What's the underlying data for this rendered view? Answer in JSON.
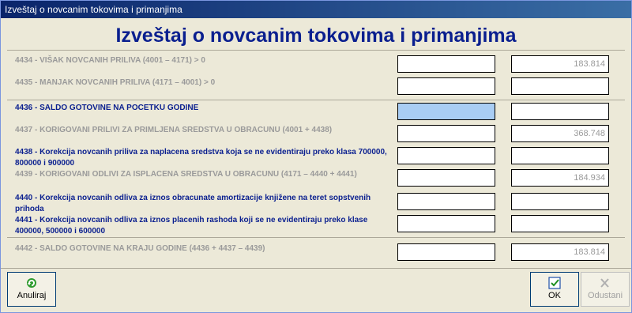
{
  "window": {
    "title": "Izveštaj o novcanim tokovima i primanjima"
  },
  "heading": "Izveštaj o novcanim tokovima i primanjima",
  "rows": [
    {
      "label": "4434 - VIŠAK NOVCANIH PRILIVA (4001 – 4171) > 0",
      "left": "",
      "right": "183.814"
    },
    {
      "label": "4435 - MANJAK NOVCANIH PRILIVA (4171 – 4001) > 0",
      "left": "",
      "right": ""
    },
    {
      "label": "4436 - SALDO GOTOVINE NA POCETKU GODINE",
      "left": "",
      "right": ""
    },
    {
      "label": "4437 - KORIGOVANI PRILIVI ZA PRIMLJENA SREDSTVA U OBRACUNU (4001 + 4438)",
      "left": "",
      "right": "368.748"
    },
    {
      "label": "4438 - Korekcija novcanih priliva za naplacena sredstva koja se ne evidentiraju preko klasa 700000, 800000 i 900000",
      "left": "",
      "right": ""
    },
    {
      "label": "4439 - KORIGOVANI ODLIVI ZA ISPLACENA SREDSTVA U OBRACUNU (4171 – 4440 + 4441)",
      "left": "",
      "right": "184.934"
    },
    {
      "label": "4440 - Korekcija novcanih odliva za iznos obracunate amortizacije knjižene na teret sopstvenih prihoda",
      "left": "",
      "right": ""
    },
    {
      "label": "4441 - Korekcija novcanih odliva za iznos placenih rashoda koji se ne evidentiraju preko klase 400000, 500000 i 600000",
      "left": "",
      "right": ""
    },
    {
      "label": "4442 - SALDO GOTOVINE NA KRAJU GODINE (4436 + 4437 – 4439)",
      "left": "",
      "right": "183.814"
    }
  ],
  "buttons": {
    "cancel": "Anuliraj",
    "ok": "OK",
    "abort": "Odustani"
  },
  "colors": {
    "title_text": "#0a1f8f",
    "focus": "#a9cdf4"
  }
}
